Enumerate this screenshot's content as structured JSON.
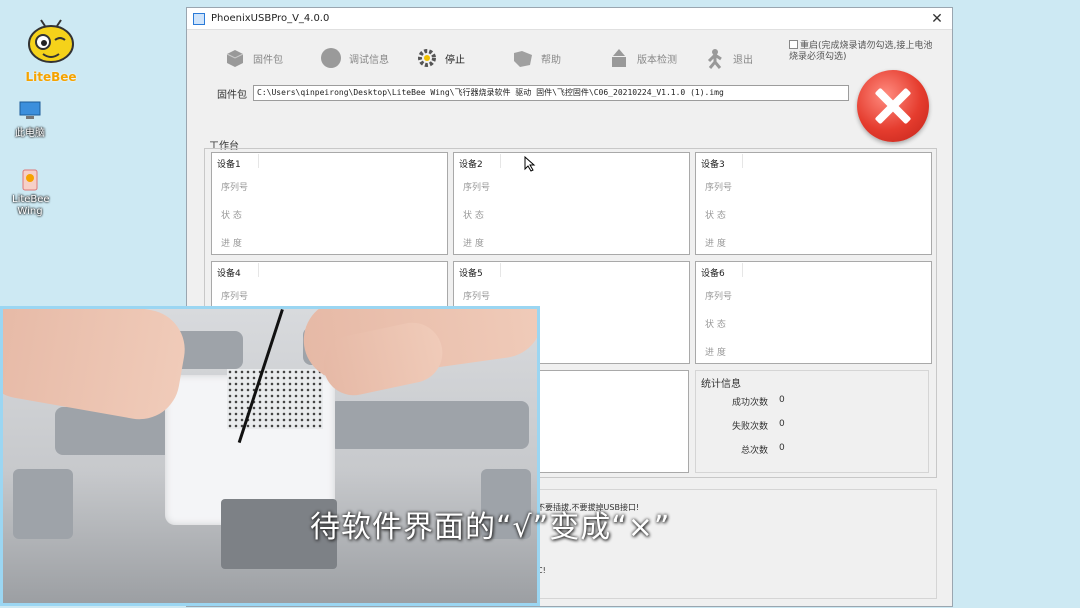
{
  "desktop": {
    "logo_text": "LiteBee",
    "icons": [
      {
        "label": "此电脑"
      },
      {
        "label": "LiteBee Wing"
      }
    ]
  },
  "window": {
    "title": "PhoenixUSBPro_V_4.0.0",
    "close_glyph": "✕"
  },
  "toolbar": {
    "items": [
      {
        "label": "固件包",
        "icon": "package-icon"
      },
      {
        "label": "调试信息",
        "icon": "debug-icon"
      },
      {
        "label": "停止",
        "icon": "gear-icon"
      },
      {
        "label": "帮助",
        "icon": "help-icon"
      },
      {
        "label": "版本检测",
        "icon": "version-icon"
      },
      {
        "label": "退出",
        "icon": "exit-icon"
      }
    ],
    "restart_label": "重启(完成烧录请勿勾选,接上电池烧录必须勾选)"
  },
  "firmware": {
    "label": "固件包",
    "path": "C:\\Users\\qinpeirong\\Desktop\\LiteBee Wing\\飞行器烧录软件 驱动 固件\\飞控固件\\C06_20210224_V1.1.0 (1).img"
  },
  "status_indicator": {
    "icon": "red-x-icon",
    "color": "#e53c2e"
  },
  "workbench": {
    "label": "工作台",
    "row_labels": {
      "serial": "序列号",
      "state": "状  态",
      "progress": "进  度"
    },
    "devices": [
      {
        "name": "设备1"
      },
      {
        "name": "设备2"
      },
      {
        "name": "设备3"
      },
      {
        "name": "设备4"
      },
      {
        "name": "设备5"
      },
      {
        "name": "设备6"
      }
    ]
  },
  "stats": {
    "title": "统计信息",
    "rows": [
      {
        "label": "成功次数",
        "value": "0"
      },
      {
        "label": "失败次数",
        "value": "0"
      },
      {
        "label": "总次数",
        "value": "0"
      }
    ]
  },
  "bottom": {
    "line1": "不要插拔,不要拔掉USB接口!",
    "line2": "C!"
  },
  "video": {
    "subtitle": "待软件界面的“√”变成“×”"
  }
}
